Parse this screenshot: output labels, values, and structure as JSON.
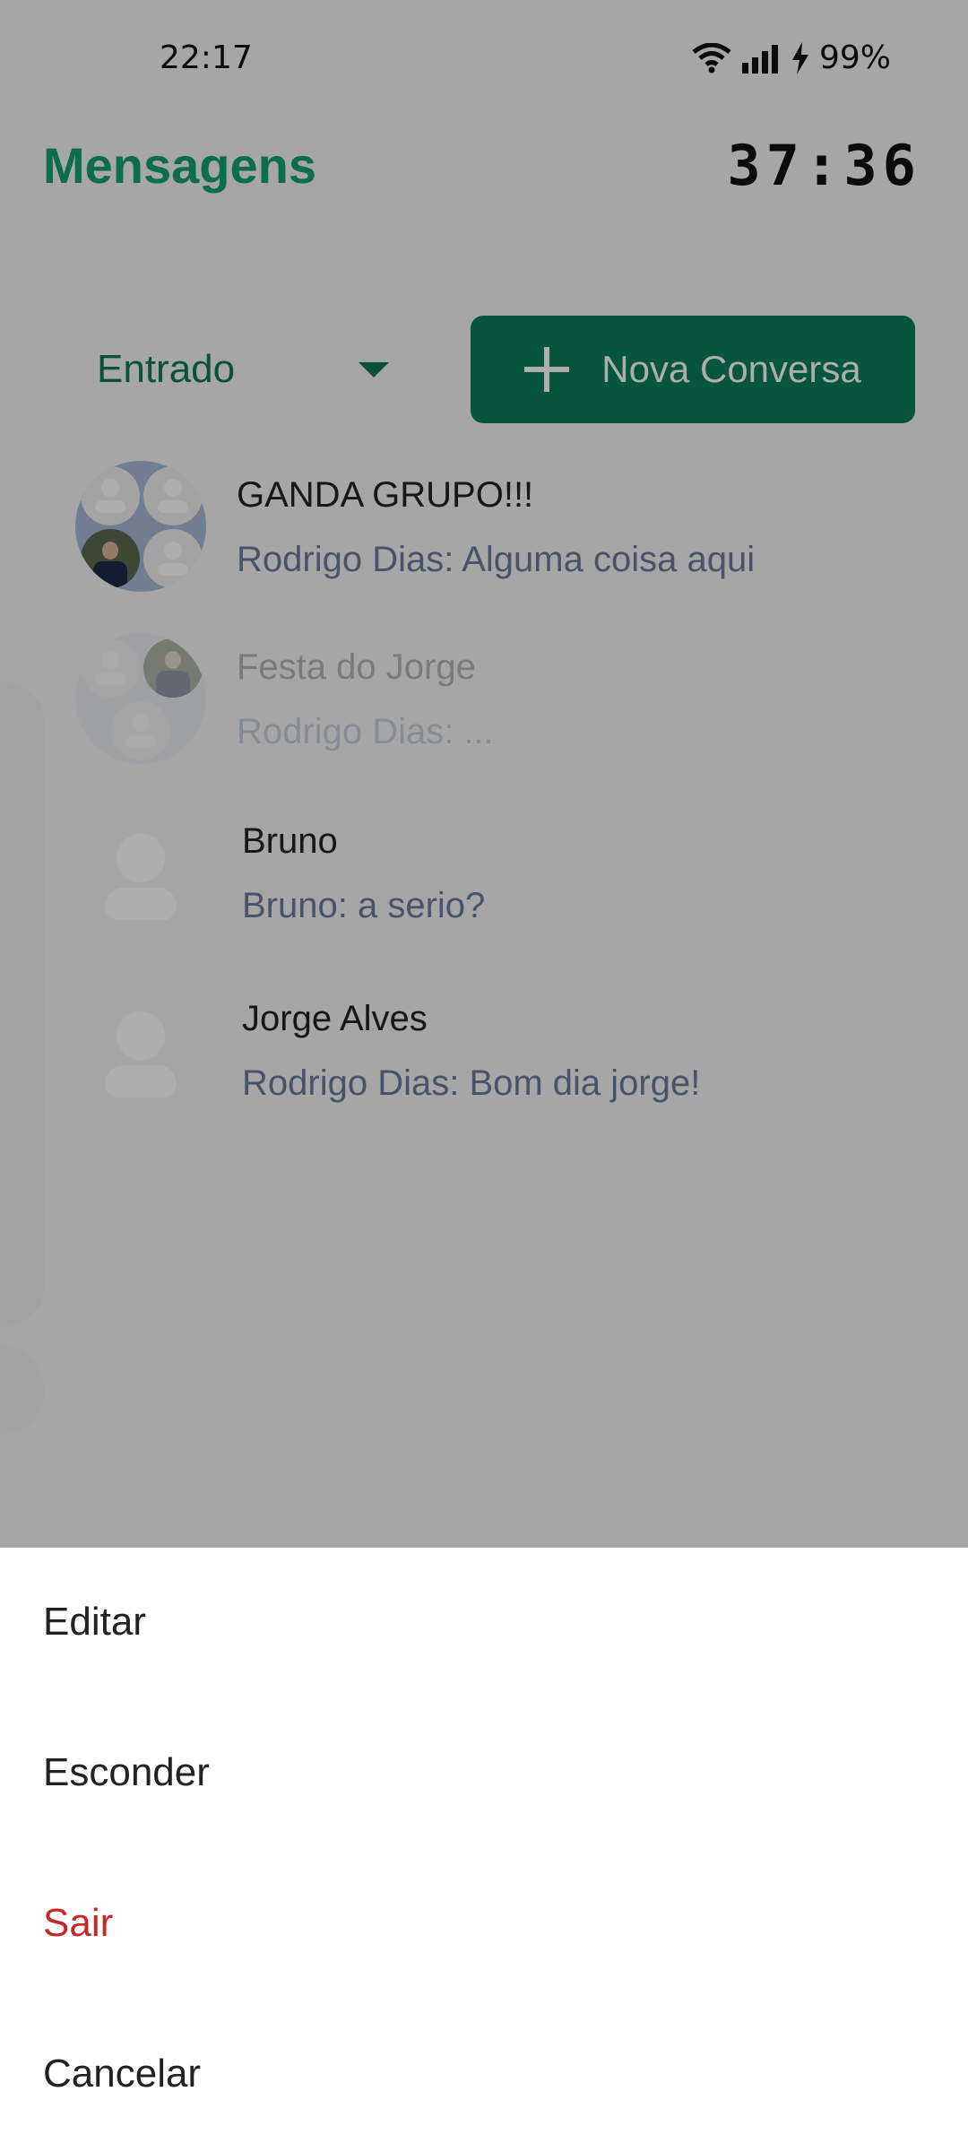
{
  "status_bar": {
    "time": "22:17",
    "battery": "99%"
  },
  "header": {
    "title": "Mensagens",
    "timer": "37:36"
  },
  "filter": {
    "selected": "Entrado"
  },
  "new_conversation": {
    "label": "Nova Conversa",
    "icon": "plus-icon"
  },
  "conversations": [
    {
      "name": "GANDA GRUPO!!!",
      "preview": "Rodrigo Dias: Alguma coisa aqui"
    },
    {
      "name": "Festa do Jorge",
      "preview": "Rodrigo Dias: ..."
    },
    {
      "name": "Bruno",
      "preview": "Bruno: a serio?"
    },
    {
      "name": "Jorge Alves",
      "preview": "Rodrigo Dias: Bom dia jorge!"
    }
  ],
  "action_sheet": {
    "edit": "Editar",
    "hide": "Esconder",
    "leave": "Sair",
    "cancel": "Cancelar"
  },
  "colors": {
    "accent": "#12a074",
    "button": "#087f5b",
    "danger": "#c62828"
  }
}
